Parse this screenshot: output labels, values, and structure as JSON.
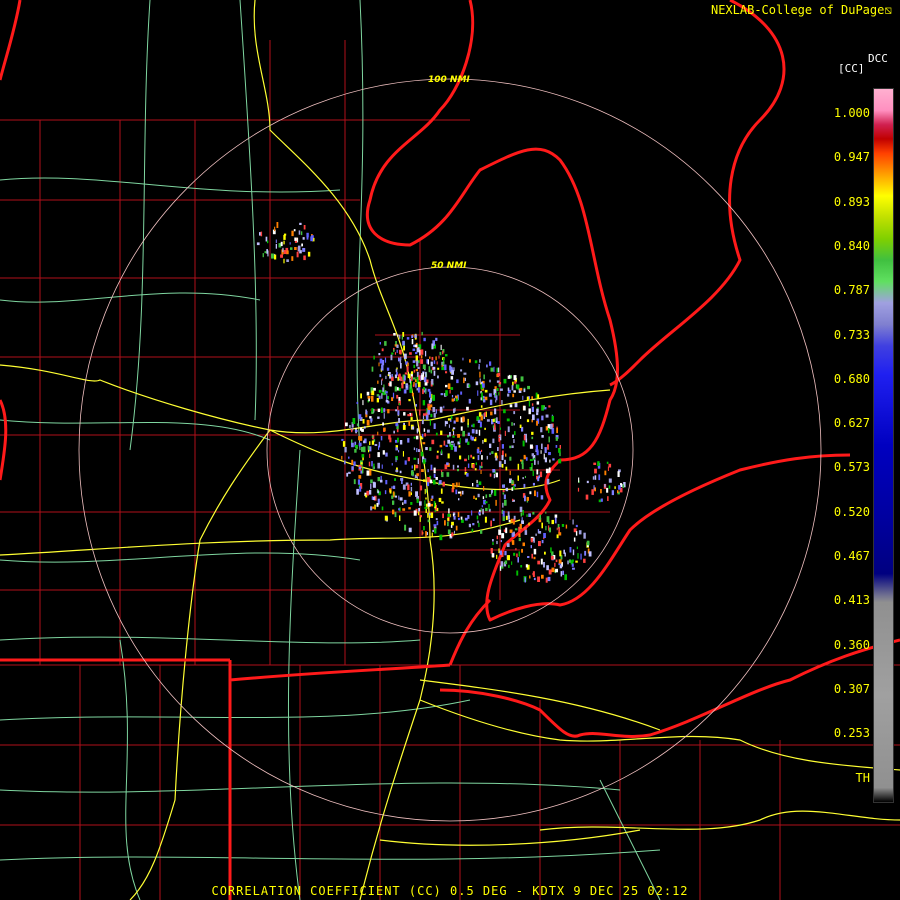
{
  "credit": "NEXLAB-College of DuPage",
  "credit_logo": "⧅",
  "legend": {
    "unit": "[CC]",
    "title": "DCC",
    "labels": [
      "1.000",
      "0.947",
      "0.893",
      "0.840",
      "0.787",
      "0.733",
      "0.680",
      "0.627",
      "0.573",
      "0.520",
      "0.467",
      "0.413",
      "0.360",
      "0.307",
      "0.253",
      "TH"
    ]
  },
  "rings": {
    "inner_label": "50 NMI",
    "outer_label": "100 NMI"
  },
  "footer": "CORRELATION COEFFICIENT (CC) 0.5 DEG - KDTX 9 DEC 25 02:12",
  "colors": {
    "background": "#000000",
    "state_border": "#ff1a1a",
    "county_line": "#b0101a",
    "highway": "#ffff33",
    "road": "#7fd6a0",
    "range_ring": "#f0c0c0",
    "text": "#ffff00"
  }
}
